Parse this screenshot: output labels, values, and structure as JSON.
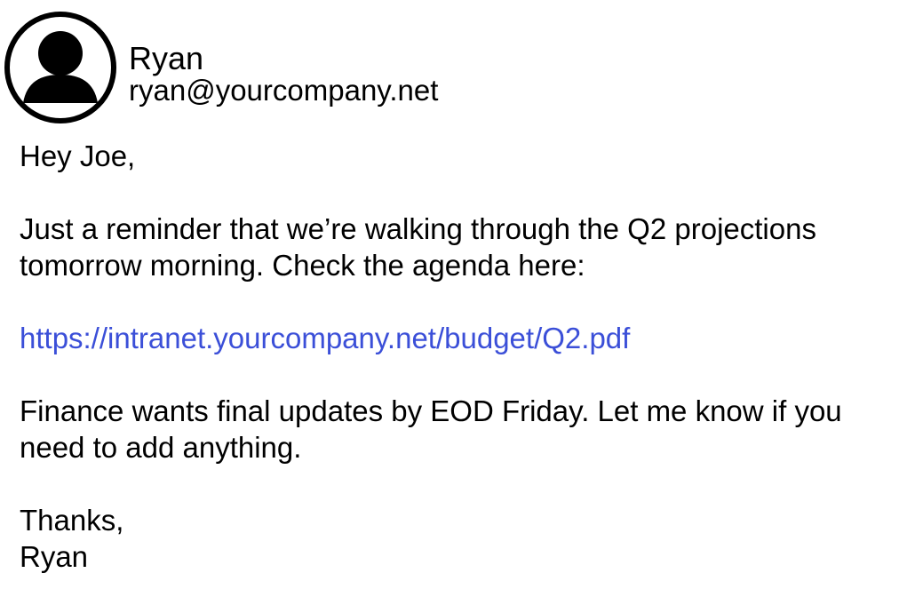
{
  "sender": {
    "name": "Ryan",
    "email": "ryan@yourcompany.net",
    "avatar_icon": "user-avatar-icon"
  },
  "body": {
    "greeting": "Hey Joe,",
    "paragraph1": {
      "line1": "Just a reminder that we’re walking through the Q2 projections",
      "line2": "tomorrow morning. Check the agenda here:"
    },
    "link": "https://intranet.yourcompany.net/budget/Q2.pdf",
    "paragraph2": {
      "line1": "Finance wants final updates by EOD Friday. Let me know if you",
      "line2": "need to add anything."
    },
    "signoff": "Thanks,",
    "signature": "Ryan"
  },
  "colors": {
    "text": "#000000",
    "link": "#3b4fd8",
    "background": "#ffffff"
  }
}
